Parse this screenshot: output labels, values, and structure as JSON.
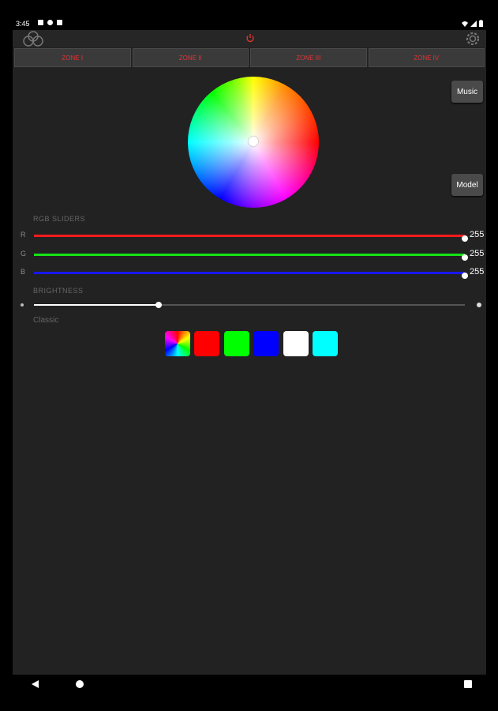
{
  "status_bar": {
    "time": "3:45"
  },
  "zones": [
    "ZONE I",
    "ZONE II",
    "ZONE III",
    "ZONE IV"
  ],
  "buttons": {
    "music": "Music",
    "model": "Model"
  },
  "rgb": {
    "label": "RGB SLIDERS",
    "sliders": [
      {
        "letter": "R",
        "value": "255",
        "color": "#ff1b1b"
      },
      {
        "letter": "G",
        "value": "255",
        "color": "#16e316"
      },
      {
        "letter": "B",
        "value": "255",
        "color": "#1818ff"
      }
    ]
  },
  "brightness": {
    "label": "BRIGHTNESS",
    "level": 0.29
  },
  "classic": {
    "label": "Classic",
    "swatches": [
      {
        "name": "rainbow"
      },
      {
        "name": "red",
        "color": "#ff0000"
      },
      {
        "name": "green",
        "color": "#00ff00"
      },
      {
        "name": "blue",
        "color": "#0000ff"
      },
      {
        "name": "white",
        "color": "#ffffff"
      },
      {
        "name": "cyan",
        "color": "#00ffff"
      }
    ]
  },
  "accent": "#e33333"
}
